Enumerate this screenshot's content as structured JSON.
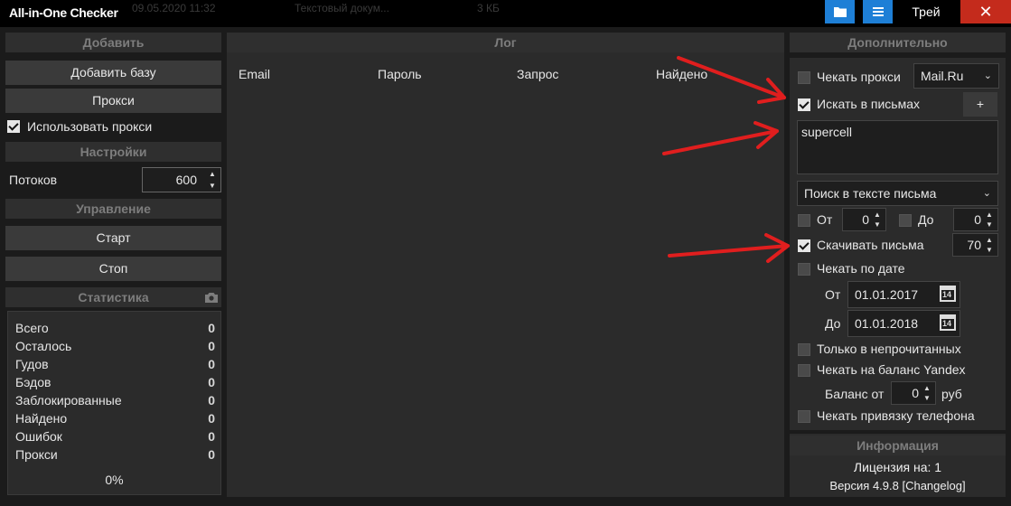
{
  "titlebar": {
    "app_title": "All-in-One Checker",
    "bg_date": "09.05.2020 11:32",
    "bg_type": "Текстовый докум...",
    "bg_size": "3 КБ",
    "tray_label": "Трей",
    "close_glyph": "✕"
  },
  "left": {
    "add_header": "Добавить",
    "add_base": "Добавить базу",
    "proxy": "Прокси",
    "use_proxy": "Использовать прокси",
    "use_proxy_checked": true,
    "settings_header": "Настройки",
    "threads_label": "Потоков",
    "threads_value": "600",
    "control_header": "Управление",
    "start": "Старт",
    "stop": "Стоп",
    "stats_header": "Статистика",
    "stats": [
      {
        "label": "Всего",
        "value": "0"
      },
      {
        "label": "Осталось",
        "value": "0"
      },
      {
        "label": "Гудов",
        "value": "0"
      },
      {
        "label": "Бэдов",
        "value": "0"
      },
      {
        "label": "Заблокированные",
        "value": "0"
      },
      {
        "label": "Найдено",
        "value": "0"
      },
      {
        "label": "Ошибок",
        "value": "0"
      },
      {
        "label": "Прокси",
        "value": "0"
      }
    ],
    "progress": "0%"
  },
  "log": {
    "header": "Лог",
    "columns": [
      "Email",
      "Пароль",
      "Запрос",
      "Найдено"
    ]
  },
  "right": {
    "header": "Дополнительно",
    "check_proxy": "Чекать прокси",
    "check_proxy_checked": false,
    "proxy_service": "Mail.Ru",
    "search_in_mail": "Искать в письмах",
    "search_in_mail_checked": true,
    "add_btn": "+",
    "search_text": "supercell",
    "search_mode": "Поиск в тексте письма",
    "from_label": "От",
    "from_checked": false,
    "from_value": "0",
    "to_label": "До",
    "to_checked": false,
    "to_value": "0",
    "download_mail": "Скачивать письма",
    "download_mail_checked": true,
    "download_count": "70",
    "check_by_date": "Чекать по дате",
    "check_by_date_checked": false,
    "date_from_label": "От",
    "date_from": "01.01.2017",
    "date_to_label": "До",
    "date_to": "01.01.2018",
    "calendar_day": "14",
    "only_unread": "Только в непрочитанных",
    "only_unread_checked": false,
    "yandex_balance": "Чекать на баланс Yandex",
    "yandex_balance_checked": false,
    "balance_from_label": "Баланс от",
    "balance_from_value": "0",
    "balance_unit": "руб",
    "phone_binding": "Чекать привязку телефона",
    "phone_binding_checked": false
  },
  "info": {
    "header": "Информация",
    "license": "Лицензия на: 1",
    "version": "Версия 4.9.8 [Changelog]"
  }
}
